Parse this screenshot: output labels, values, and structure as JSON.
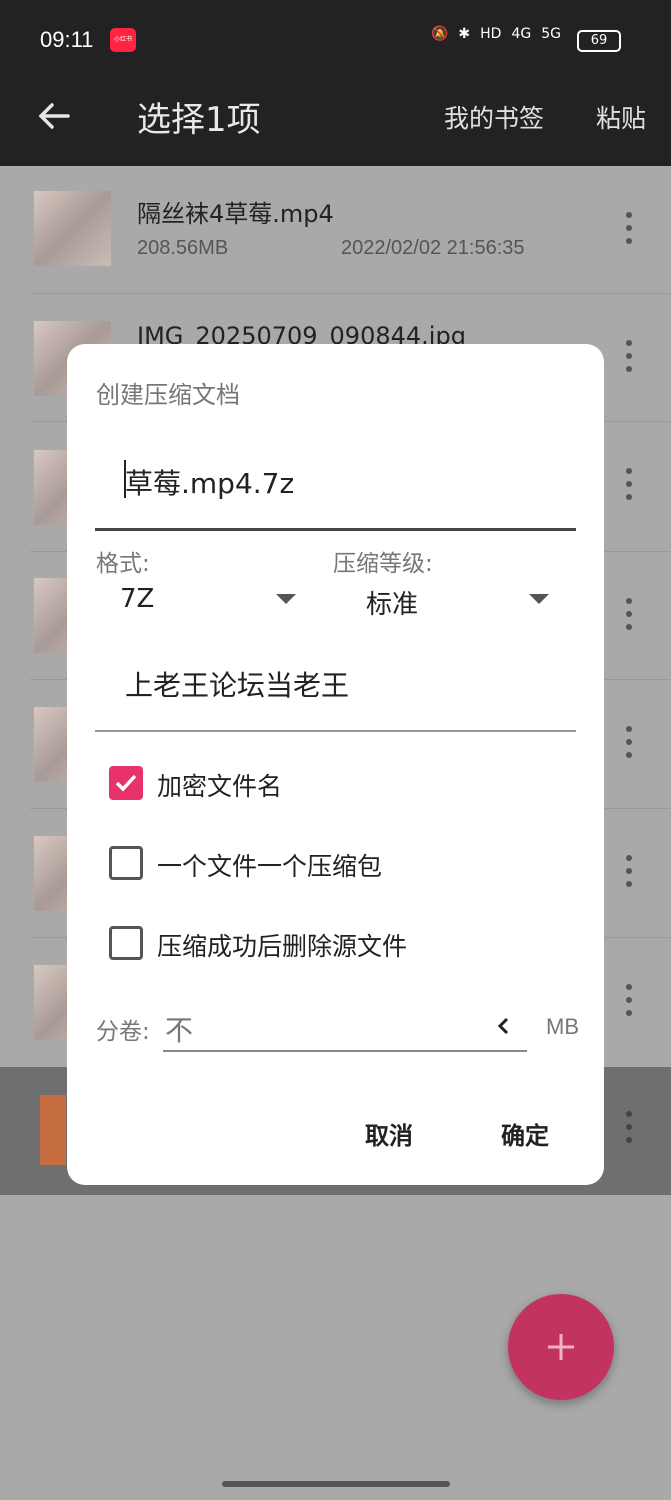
{
  "status": {
    "time": "09:11",
    "app_badge": "小红书",
    "battery": "69",
    "network": [
      "HD",
      "4G",
      "5G"
    ]
  },
  "topbar": {
    "title": "选择1项",
    "bookmarks": "我的书签",
    "paste": "粘贴"
  },
  "files": [
    {
      "name": "隔丝袜4草莓.mp4",
      "size": "208.56MB",
      "date": "2022/02/02 21:56:35"
    },
    {
      "name": "IMG_20250709_090844.jpg",
      "size": "",
      "date": ""
    }
  ],
  "dialog": {
    "title": "创建压缩文档",
    "filename": "草莓.mp4.7z",
    "format_label": "格式:",
    "format_value": "7Z",
    "level_label": "压缩等级:",
    "level_value": "标准",
    "password": "上老王论坛当老王",
    "options": [
      {
        "label": "加密文件名",
        "checked": true
      },
      {
        "label": "一个文件一个压缩包",
        "checked": false
      },
      {
        "label": "压缩成功后删除源文件",
        "checked": false
      }
    ],
    "volume_label": "分卷:",
    "volume_value": "不",
    "volume_unit": "MB",
    "cancel": "取消",
    "ok": "确定"
  },
  "fab": {
    "icon": "plus-icon"
  },
  "colors": {
    "accent": "#e8336a",
    "fab": "#c2335f",
    "bar": "#222222"
  }
}
